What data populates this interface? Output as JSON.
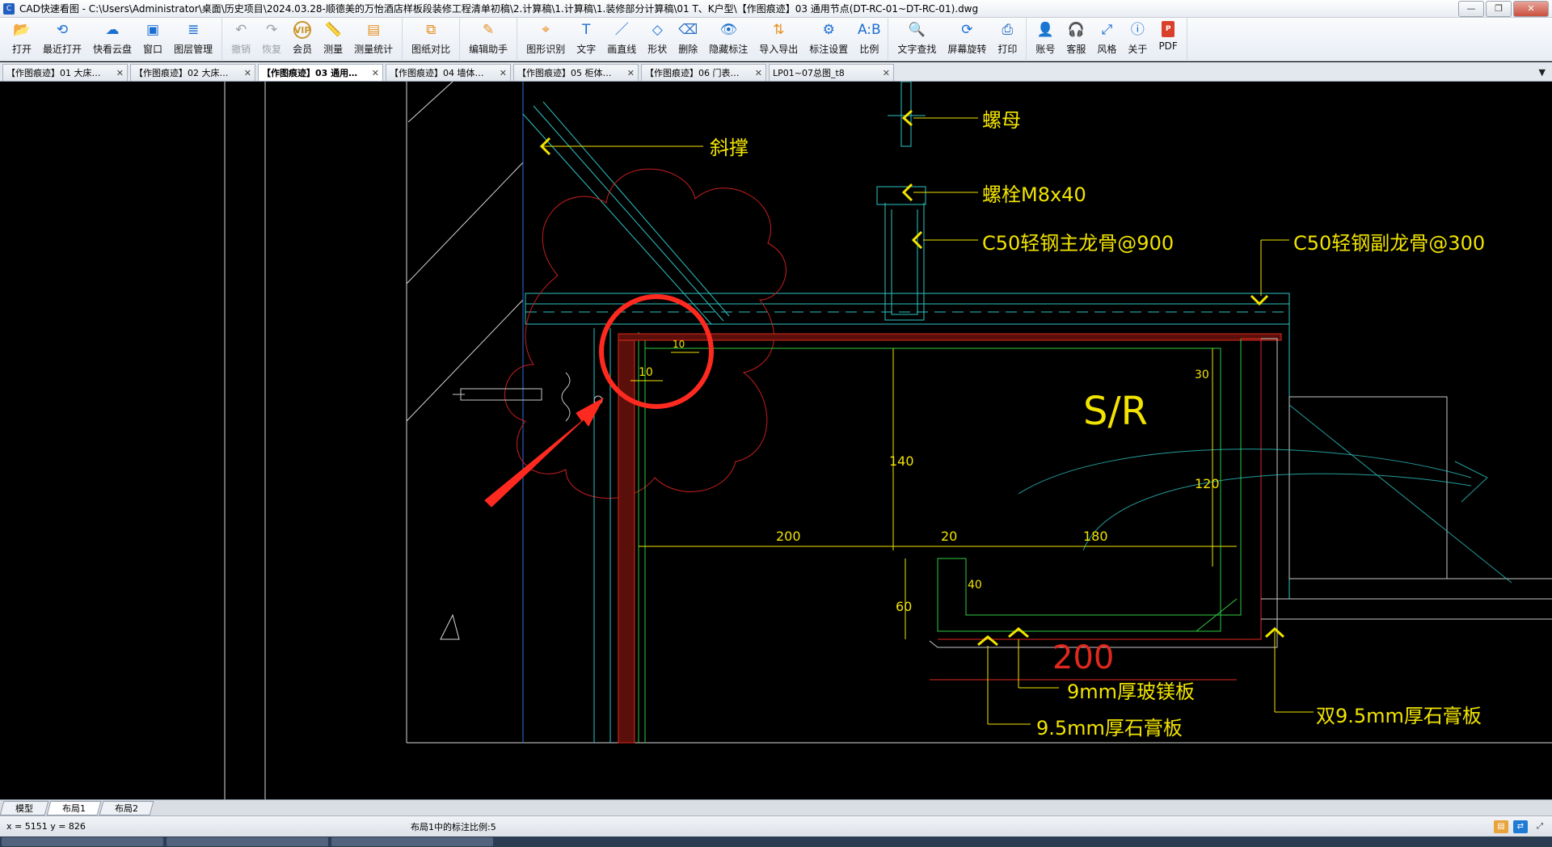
{
  "window": {
    "app_name": "CAD快速看图",
    "title": "CAD快速看图 - C:\\Users\\Administrator\\桌面\\历史项目\\2024.03.28-顺德美的万怡酒店样板段装修工程清单初稿\\2.计算稿\\1.计算稿\\1.装修部分计算稿\\01 T、K户型\\【作图痕迹】03 通用节点(DT-RC-01~DT-RC-01).dwg",
    "min": "—",
    "max": "❐",
    "close": "✕"
  },
  "toolbar": {
    "groups": [
      [
        {
          "id": "open",
          "label": "打开",
          "icon": "folder-open-icon",
          "glyph": "📂",
          "enabled": true
        },
        {
          "id": "recent",
          "label": "最近打开",
          "icon": "clock-icon",
          "glyph": "⟲",
          "enabled": true
        },
        {
          "id": "cloud",
          "label": "快看云盘",
          "icon": "cloud-icon",
          "glyph": "☁",
          "enabled": true
        },
        {
          "id": "window",
          "label": "窗口",
          "icon": "window-icon",
          "glyph": "▣",
          "enabled": true
        },
        {
          "id": "layers",
          "label": "图层管理",
          "icon": "layers-icon",
          "glyph": "≣",
          "enabled": true
        }
      ],
      [
        {
          "id": "undo",
          "label": "撤销",
          "icon": "undo-icon",
          "glyph": "↶",
          "enabled": false
        },
        {
          "id": "redo",
          "label": "恢复",
          "icon": "redo-icon",
          "glyph": "↷",
          "enabled": false
        },
        {
          "id": "vip",
          "label": "会员",
          "icon": "vip-icon",
          "glyph": "VIP",
          "enabled": true
        },
        {
          "id": "measure",
          "label": "测量",
          "icon": "ruler-icon",
          "glyph": "📏",
          "enabled": true
        },
        {
          "id": "measure-stats",
          "label": "测量统计",
          "icon": "stats-icon",
          "glyph": "▤",
          "enabled": true
        }
      ],
      [
        {
          "id": "compare",
          "label": "图纸对比",
          "icon": "compare-icon",
          "glyph": "⧉",
          "enabled": true
        }
      ],
      [
        {
          "id": "edit-assistant",
          "label": "编辑助手",
          "icon": "edit-icon",
          "glyph": "✎",
          "enabled": true
        }
      ],
      [
        {
          "id": "shape-recognition",
          "label": "图形识别",
          "icon": "shape-recognition-icon",
          "glyph": "⌖",
          "enabled": true
        },
        {
          "id": "text",
          "label": "文字",
          "icon": "text-icon",
          "glyph": "T",
          "enabled": true
        },
        {
          "id": "line",
          "label": "画直线",
          "icon": "line-icon",
          "glyph": "／",
          "enabled": true
        },
        {
          "id": "shape",
          "label": "形状",
          "icon": "shape-icon",
          "glyph": "◇",
          "enabled": true
        },
        {
          "id": "erase",
          "label": "删除",
          "icon": "eraser-icon",
          "glyph": "⌫",
          "enabled": true
        },
        {
          "id": "hide-annotation",
          "label": "隐藏标注",
          "icon": "eye-icon",
          "glyph": "👁",
          "enabled": true
        },
        {
          "id": "import-export",
          "label": "导入导出",
          "icon": "import-export-icon",
          "glyph": "⇅",
          "enabled": true
        },
        {
          "id": "annotation-settings",
          "label": "标注设置",
          "icon": "settings-icon",
          "glyph": "⚙",
          "enabled": true
        },
        {
          "id": "scale",
          "label": "比例",
          "icon": "scale-icon",
          "glyph": "A:B",
          "enabled": true
        }
      ],
      [
        {
          "id": "find-text",
          "label": "文字查找",
          "icon": "search-icon",
          "glyph": "🔍",
          "enabled": true
        },
        {
          "id": "rotate-screen",
          "label": "屏幕旋转",
          "icon": "rotate-icon",
          "glyph": "⟳",
          "enabled": true
        },
        {
          "id": "print",
          "label": "打印",
          "icon": "printer-icon",
          "glyph": "⎙",
          "enabled": true
        }
      ],
      [
        {
          "id": "account",
          "label": "账号",
          "icon": "user-icon",
          "glyph": "👤",
          "enabled": true
        },
        {
          "id": "support",
          "label": "客服",
          "icon": "headset-icon",
          "glyph": "🎧",
          "enabled": true
        },
        {
          "id": "style",
          "label": "风格",
          "icon": "style-icon",
          "glyph": "⤢",
          "enabled": true
        },
        {
          "id": "about",
          "label": "关于",
          "icon": "info-icon",
          "glyph": "ⓘ",
          "enabled": true
        },
        {
          "id": "pdf",
          "label": "PDF",
          "icon": "pdf-icon",
          "glyph": "P",
          "enabled": true
        }
      ]
    ]
  },
  "tabs": [
    {
      "label": "【作图痕迹】01 大床…",
      "close": "✕",
      "active": false
    },
    {
      "label": "【作图痕迹】02 大床…",
      "close": "✕",
      "active": false
    },
    {
      "label": "【作图痕迹】03 通用…",
      "close": "✕",
      "active": true
    },
    {
      "label": "【作图痕迹】04 墙体…",
      "close": "✕",
      "active": false
    },
    {
      "label": "【作图痕迹】05 柜体…",
      "close": "✕",
      "active": false
    },
    {
      "label": "【作图痕迹】06 门表…",
      "close": "✕",
      "active": false
    },
    {
      "label": "LP01~07总图_t8",
      "close": "✕",
      "active": false
    }
  ],
  "tab_menu": "▼",
  "drawing": {
    "labels": {
      "brace": "斜撑",
      "nut": "螺母",
      "bolt": "螺栓M8x40",
      "main_keel": "C50轻钢主龙骨@900",
      "sub_keel": "C50轻钢副龙骨@300",
      "room": "S/R",
      "glass_mgo": "9mm厚玻镁板",
      "gypsum_single": "9.5mm厚石膏板",
      "gypsum_double": "双9.5mm厚石膏板"
    },
    "dimensions": {
      "d10a": "10",
      "d10b": "10",
      "d30": "30",
      "d140": "140",
      "d120": "120",
      "d200": "200",
      "d20": "20",
      "d180": "180",
      "d60": "60",
      "d40": "40",
      "d200_big": "200"
    },
    "colors": {
      "text": "#f2e400",
      "line_cyan": "#2ec4c4",
      "line_red": "#e0281e",
      "line_green": "#2ecc40",
      "markup_red": "#ff2a1f"
    }
  },
  "layout_tabs": [
    {
      "label": "模型",
      "active": false
    },
    {
      "label": "布局1",
      "active": true
    },
    {
      "label": "布局2",
      "active": false
    }
  ],
  "status": {
    "coords": "x = 5151  y = 826",
    "scale_text": "布局1中的标注比例:5"
  }
}
